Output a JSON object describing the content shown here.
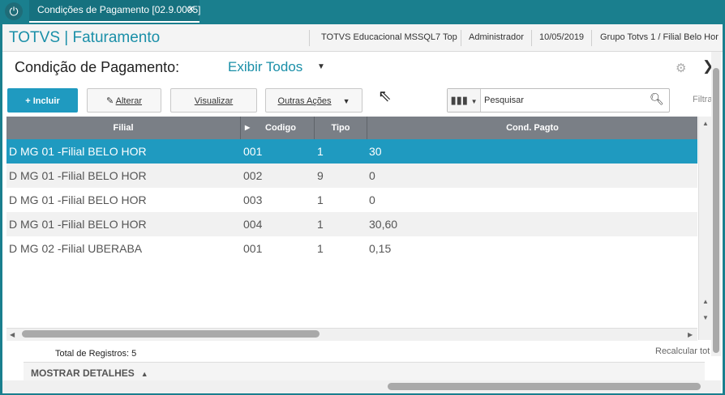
{
  "tab": {
    "title": "Condições de Pagamento [02.9.0005]",
    "close": "✕"
  },
  "header": {
    "app_title": "TOTVS | Faturamento",
    "environment": "TOTVS Educacional MSSQL7 Top",
    "user": "Administrador",
    "date": "10/05/2019",
    "company": "Grupo Totvs 1 / Filial Belo Hor"
  },
  "page": {
    "title": "Condição de Pagamento:",
    "view_filter": "Exibir Todos"
  },
  "toolbar": {
    "incluir": "+ Incluir",
    "alterar": "Alterar",
    "visualizar": "Visualizar",
    "outras_acoes": "Outras Ações"
  },
  "search": {
    "placeholder": "Pesquisar",
    "filter_label": "Filtra"
  },
  "grid": {
    "columns": [
      "Filial",
      "Codigo",
      "Tipo",
      "Cond. Pagto"
    ],
    "rows": [
      {
        "filial": "D MG 01 -Filial BELO HOR",
        "codigo": "001",
        "tipo": "1",
        "cond": "30"
      },
      {
        "filial": "D MG 01 -Filial BELO HOR",
        "codigo": "002",
        "tipo": "9",
        "cond": "0"
      },
      {
        "filial": "D MG 01 -Filial BELO HOR",
        "codigo": "003",
        "tipo": "1",
        "cond": "0"
      },
      {
        "filial": "D MG 01 -Filial BELO HOR",
        "codigo": "004",
        "tipo": "1",
        "cond": "30,60"
      },
      {
        "filial": "D MG 02 -Filial UBERABA",
        "codigo": "001",
        "tipo": "1",
        "cond": "0,15"
      }
    ],
    "selected_row": 1
  },
  "footer": {
    "total": "Total de Registros: 5",
    "recalc": "Recalcular tot",
    "details": "MOSTRAR DETALHES"
  },
  "colors": {
    "accent": "#1a8fa8",
    "selected": "#1f9ac0",
    "header_bg": "#7a7f86"
  }
}
